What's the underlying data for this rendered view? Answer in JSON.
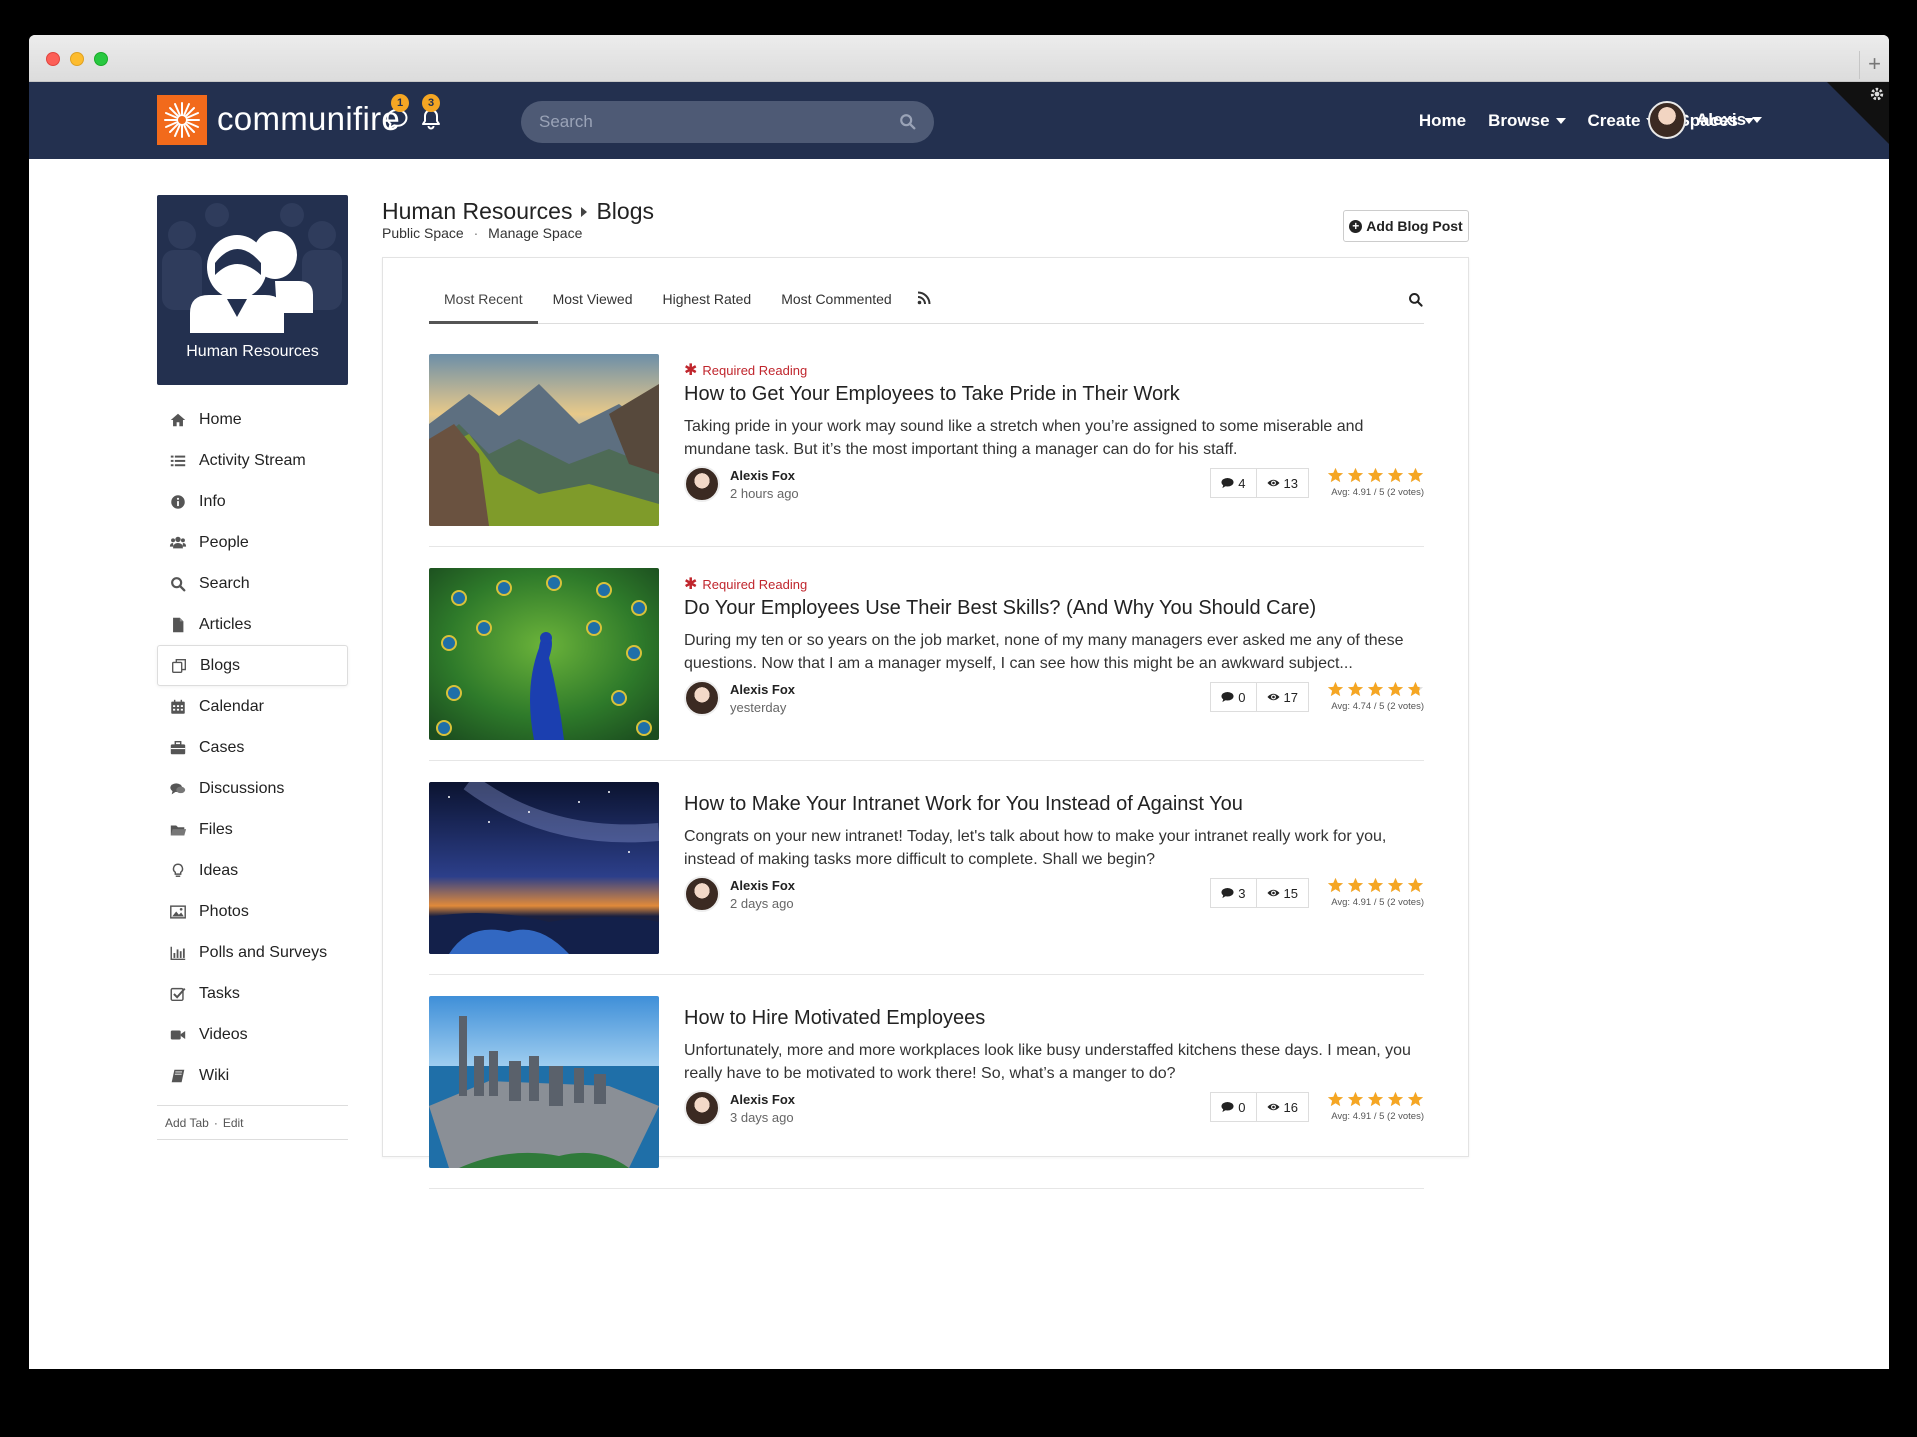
{
  "app": {
    "logo_text": "communifire",
    "chat_badge": "1",
    "notification_badge": "3",
    "search_placeholder": "Search",
    "nav": [
      {
        "label": "Home",
        "dropdown": false
      },
      {
        "label": "Browse",
        "dropdown": true
      },
      {
        "label": "Create",
        "dropdown": true
      },
      {
        "label": "Spaces",
        "dropdown": true
      }
    ],
    "user_name": "Alexis"
  },
  "space": {
    "name": "Human Resources",
    "breadcrumb_current": "Blogs",
    "public_label": "Public Space",
    "manage_label": "Manage Space",
    "add_button": "Add Blog Post"
  },
  "sidebar": {
    "items": [
      {
        "label": "Home",
        "icon": "home-icon"
      },
      {
        "label": "Activity Stream",
        "icon": "list-icon"
      },
      {
        "label": "Info",
        "icon": "info-icon"
      },
      {
        "label": "People",
        "icon": "people-icon"
      },
      {
        "label": "Search",
        "icon": "search-icon"
      },
      {
        "label": "Articles",
        "icon": "document-icon"
      },
      {
        "label": "Blogs",
        "icon": "blogs-icon",
        "active": true
      },
      {
        "label": "Calendar",
        "icon": "calendar-icon"
      },
      {
        "label": "Cases",
        "icon": "briefcase-icon"
      },
      {
        "label": "Discussions",
        "icon": "comments-icon"
      },
      {
        "label": "Files",
        "icon": "folder-icon"
      },
      {
        "label": "Ideas",
        "icon": "lightbulb-icon"
      },
      {
        "label": "Photos",
        "icon": "image-icon"
      },
      {
        "label": "Polls and Surveys",
        "icon": "bar-chart-icon"
      },
      {
        "label": "Tasks",
        "icon": "checkbox-icon"
      },
      {
        "label": "Videos",
        "icon": "video-icon"
      },
      {
        "label": "Wiki",
        "icon": "book-icon"
      }
    ],
    "footer_add": "Add Tab",
    "footer_edit": "Edit"
  },
  "tabs": [
    "Most Recent",
    "Most Viewed",
    "Highest Rated",
    "Most Commented"
  ],
  "required_label": "Required Reading",
  "posts": [
    {
      "required": true,
      "title": "How to Get Your Employees to Take Pride in Their Work",
      "excerpt": "Taking pride in your work may sound like a stretch when you’re assigned to some miserable and mundane task. But it’s the most important thing a manager can do for his staff.",
      "author": "Alexis Fox",
      "time": "2 hours ago",
      "comments": "4",
      "views": "13",
      "rating": 4.91,
      "avg": "Avg: 4.91 / 5 (2 votes)",
      "image": "mountains"
    },
    {
      "required": true,
      "title": "Do Your Employees Use Their Best Skills? (And Why You Should Care)",
      "excerpt": "During my ten or so years on the job market, none of my many managers ever asked me any of these questions. Now that I am a manager myself, I can see how this might be an awkward subject...",
      "author": "Alexis Fox",
      "time": "yesterday",
      "comments": "0",
      "views": "17",
      "rating": 4.74,
      "avg": "Avg: 4.74 / 5 (2 votes)",
      "image": "peacock"
    },
    {
      "required": false,
      "title": "How to Make Your Intranet Work for You Instead of Against You",
      "excerpt": "Congrats on your new intranet! Today, let's talk about how to make your intranet really work for you, instead of making tasks more difficult to complete. Shall we begin?",
      "author": "Alexis Fox",
      "time": "2 days ago",
      "comments": "3",
      "views": "15",
      "rating": 4.91,
      "avg": "Avg: 4.91 / 5 (2 votes)",
      "image": "night-sky"
    },
    {
      "required": false,
      "title": "How to Hire Motivated Employees",
      "excerpt": "Unfortunately, more and more workplaces look like busy understaffed kitchens these days. I mean, you really have to be motivated to work there! So, what’s a manger to do?",
      "author": "Alexis Fox",
      "time": "3 days ago",
      "comments": "0",
      "views": "16",
      "rating": 4.91,
      "avg": "Avg: 4.91 / 5 (2 votes)",
      "image": "city"
    }
  ],
  "colors": {
    "nav_bg": "#23304f",
    "brand_orange": "#f26a1b",
    "badge": "#f5a623",
    "required_red": "#c0262d",
    "star": "#f5a623"
  }
}
